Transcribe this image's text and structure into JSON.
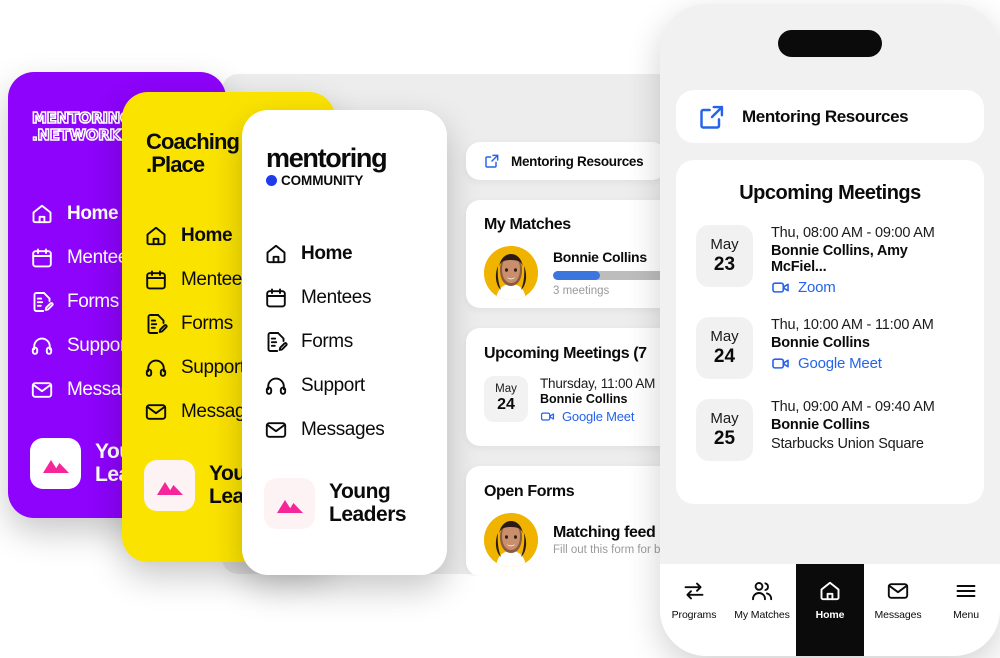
{
  "brand_cards": [
    {
      "id": "mentoring-network",
      "logo_lines": [
        "MENTORING",
        ".NETWORK"
      ],
      "style": "outline",
      "bg": "#8D03FB",
      "fg": "#FFFFFF",
      "nav": [
        {
          "label": "Home",
          "icon": "home-icon",
          "active": true
        },
        {
          "label": "Mentees",
          "icon": "calendar-icon",
          "active": false
        },
        {
          "label": "Forms",
          "icon": "form-edit-icon",
          "active": false
        },
        {
          "label": "Support",
          "icon": "headset-icon",
          "active": false
        },
        {
          "label": "Messages",
          "icon": "envelope-icon",
          "active": false
        }
      ],
      "program": {
        "name": "Young\nLeaders",
        "icon": "mountains-icon",
        "tile_bg": "#FFFFFF",
        "icon_color": "#F4269A"
      }
    },
    {
      "id": "coaching-place",
      "logo_lines": [
        "Coaching",
        ".Place"
      ],
      "style": "solid",
      "bg": "#FBE300",
      "fg": "#0B0B0B",
      "nav": [
        {
          "label": "Home",
          "icon": "home-icon",
          "active": true
        },
        {
          "label": "Mentees",
          "icon": "calendar-icon",
          "active": false
        },
        {
          "label": "Forms",
          "icon": "form-edit-icon",
          "active": false
        },
        {
          "label": "Support",
          "icon": "headset-icon",
          "active": false
        },
        {
          "label": "Messages",
          "icon": "envelope-icon",
          "active": false
        }
      ],
      "program": {
        "name": "Young\nLeaders",
        "icon": "mountains-icon",
        "tile_bg": "#FDF2F4",
        "icon_color": "#F4269A"
      }
    },
    {
      "id": "mentoring-community",
      "logo_lines": [
        "mentoring",
        "COMMUNITY"
      ],
      "style": "wordmark",
      "bg": "#FFFFFF",
      "fg": "#0B0B0B",
      "dot_color": "#1F3BEE",
      "nav": [
        {
          "label": "Home",
          "icon": "home-icon",
          "active": true
        },
        {
          "label": "Mentees",
          "icon": "calendar-icon",
          "active": false
        },
        {
          "label": "Forms",
          "icon": "form-edit-icon",
          "active": false
        },
        {
          "label": "Support",
          "icon": "headset-icon",
          "active": false
        },
        {
          "label": "Messages",
          "icon": "envelope-icon",
          "active": false
        }
      ],
      "program": {
        "name": "Young\nLeaders",
        "icon": "mountains-icon",
        "tile_bg": "#FDF2F4",
        "icon_color": "#F4269A"
      }
    }
  ],
  "desktop": {
    "bg": "#EDEDED",
    "resources": {
      "label": "Mentoring Resources",
      "icon": "external-link-icon"
    },
    "matches": {
      "title": "My Matches",
      "person": "Bonnie Collins",
      "progress_percent": 40,
      "progress_color": "#3B76DE",
      "meetings_text": "3 meetings",
      "avatar": "woman-avatar"
    },
    "meetings": {
      "title": "Upcoming Meetings (7",
      "items": [
        {
          "month": "May",
          "day": "24",
          "when": "Thursday, 11:00 AM",
          "who": "Bonnie Collins",
          "link": "Google Meet",
          "icon": "video-camera-icon"
        }
      ]
    },
    "forms": {
      "title": "Open Forms",
      "items": [
        {
          "title": "Matching feed",
          "subtitle": "Fill out this form for b",
          "avatar": "woman-avatar"
        }
      ]
    }
  },
  "phone": {
    "bg": "#F1F1F1",
    "resources": {
      "label": "Mentoring Resources",
      "icon": "external-link-icon"
    },
    "meetings": {
      "title": "Upcoming Meetings",
      "items": [
        {
          "month": "May",
          "day": "23",
          "when": "Thu, 08:00 AM - 09:00 AM",
          "who": "Bonnie Collins, Amy McFiel...",
          "link": "Zoom",
          "icon": "video-camera-icon",
          "place": ""
        },
        {
          "month": "May",
          "day": "24",
          "when": "Thu, 10:00 AM - 11:00 AM",
          "who": "Bonnie Collins",
          "link": "Google Meet",
          "icon": "video-camera-icon",
          "place": ""
        },
        {
          "month": "May",
          "day": "25",
          "when": "Thu, 09:00 AM - 09:40 AM",
          "who": "Bonnie Collins",
          "link": "",
          "icon": "",
          "place": "Starbucks Union Square"
        }
      ]
    },
    "tabbar": [
      {
        "label": "Programs",
        "icon": "swap-arrows-icon",
        "selected": false
      },
      {
        "label": "My Matches",
        "icon": "people-icon",
        "selected": false
      },
      {
        "label": "Home",
        "icon": "home-icon",
        "selected": true
      },
      {
        "label": "Messages",
        "icon": "envelope-icon",
        "selected": false
      },
      {
        "label": "Menu",
        "icon": "hamburger-icon",
        "selected": false
      }
    ]
  }
}
